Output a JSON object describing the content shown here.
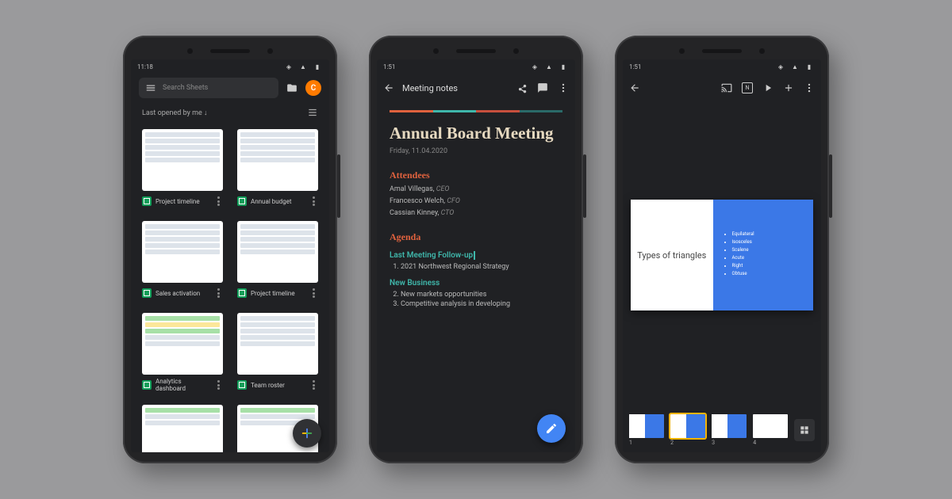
{
  "status_time_1": "11:18",
  "status_time_2": "1:51",
  "status_time_3": "1:51",
  "sheets": {
    "search_placeholder": "Search Sheets",
    "avatar_letter": "C",
    "sort_label": "Last opened by me",
    "docs": [
      {
        "title": "Project timeline"
      },
      {
        "title": "Annual budget"
      },
      {
        "title": "Sales activation"
      },
      {
        "title": "Project timeline"
      },
      {
        "title": "Analytics dashboard"
      },
      {
        "title": "Team roster"
      }
    ]
  },
  "docs": {
    "title": "Meeting notes",
    "heading": "Annual Board Meeting",
    "date": "Friday, 11.04.2020",
    "attendees_h": "Attendees",
    "attendees": [
      {
        "name": "Amal Villegas",
        "role": "CEO"
      },
      {
        "name": "Francesco Welch",
        "role": "CFO"
      },
      {
        "name": "Cassian Kinney",
        "role": "CTO"
      }
    ],
    "agenda_h": "Agenda",
    "sub1": "Last Meeting Follow-up",
    "sub1_items": [
      "2021 Northwest Regional Strategy"
    ],
    "sub2": "New Business",
    "sub2_items": [
      "New markets opportunities",
      "Competitive analysis in developing"
    ]
  },
  "slides": {
    "slide_title": "Types of triangles",
    "bullets": [
      "Equilateral",
      "Isosceles",
      "Scalene",
      "Acute",
      "Right",
      "Obtuse"
    ],
    "strip_count": 4
  }
}
